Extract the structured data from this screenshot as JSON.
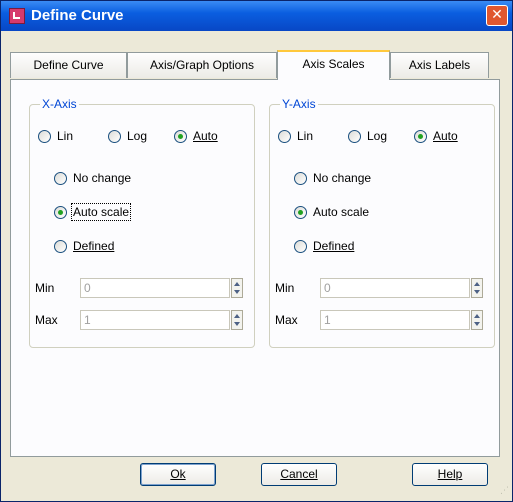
{
  "window": {
    "title": "Define Curve",
    "close_glyph": "✕"
  },
  "tabs": [
    {
      "label": "Define Curve",
      "active": false
    },
    {
      "label": "Axis/Graph Options",
      "active": false
    },
    {
      "label": "Axis Scales",
      "active": true
    },
    {
      "label": "Axis Labels",
      "active": false
    }
  ],
  "x_axis": {
    "label": "X-Axis",
    "scale_type": {
      "lin": "Lin",
      "log": "Log",
      "auto": "Auto",
      "selected": "Auto"
    },
    "scale_mode": {
      "no_change": "No change",
      "auto_scale": "Auto scale",
      "defined": "Defined",
      "selected": "Auto scale"
    },
    "min": {
      "label": "Min",
      "value": "0"
    },
    "max": {
      "label": "Max",
      "value": "1"
    }
  },
  "y_axis": {
    "label": "Y-Axis",
    "scale_type": {
      "lin": "Lin",
      "log": "Log",
      "auto": "Auto",
      "selected": "Auto"
    },
    "scale_mode": {
      "no_change": "No change",
      "auto_scale": "Auto scale",
      "defined": "Defined",
      "selected": "Auto scale"
    },
    "min": {
      "label": "Min",
      "value": "0"
    },
    "max": {
      "label": "Max",
      "value": "1"
    }
  },
  "buttons": {
    "ok": "Ok",
    "cancel": "Cancel",
    "help": "Help"
  },
  "colors": {
    "title_bar": "#0a5ee0",
    "group_label": "#0046d5",
    "close_button": "#e0572f",
    "active_tab_highlight": "#ffc83c"
  }
}
